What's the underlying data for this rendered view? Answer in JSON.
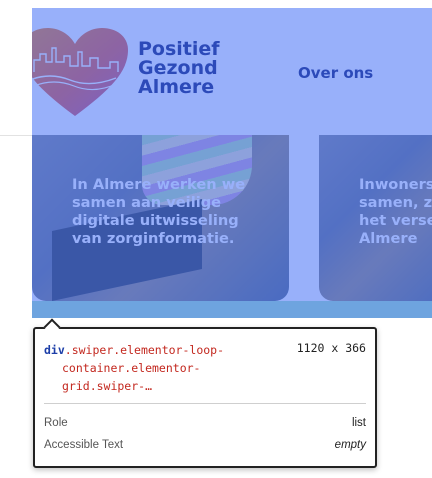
{
  "header": {
    "brand_line1": "Positief",
    "brand_line2": "Gezond",
    "brand_line3": "Almere",
    "nav_about": "Over ons"
  },
  "cards": [
    {
      "text": "In Almere werken we samen aan veilige digitale uitwisseling van zorginformatie."
    },
    {
      "line1": "Inwoners",
      "line2": "samen, z",
      "line3": "het verse",
      "line4": "Almere"
    }
  ],
  "inspector": {
    "tag": "div",
    "selector_line1": ".swiper.elementor-loop-",
    "selector_line2": "container.elementor-",
    "selector_line3": "grid.swiper-…",
    "dimensions": "1120 x 366",
    "role_label": "Role",
    "role_value": "list",
    "accessible_label": "Accessible Text",
    "accessible_value": "empty"
  },
  "colors": {
    "brand": "#1e2a78",
    "highlight_overlay": "#3967f5",
    "strip": "#a7e6c7",
    "selector_text": "#c3281f"
  },
  "icons": {
    "logo": "heart-skyline-logo"
  }
}
